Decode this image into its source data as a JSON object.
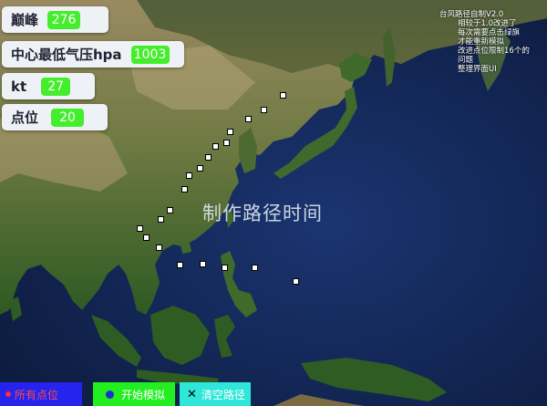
{
  "stats": {
    "peak": {
      "label": "巅峰",
      "value": "276"
    },
    "pressure": {
      "label": "中心最低气压hpa",
      "value": "1003"
    },
    "kt": {
      "label": "kt",
      "value": "27"
    },
    "points": {
      "label": "点位",
      "value": "20"
    }
  },
  "info": {
    "title": "台风路径自制V2.0",
    "notes": [
      "相较于1.0改进了",
      "每次需要点击绿旗",
      "才能重新模拟",
      "改进点位限制16个的",
      "问题",
      "整理界面UI"
    ]
  },
  "overlay_title": "制作路径时间",
  "buttons": {
    "all_points": {
      "label": "所有点位",
      "icon": "red-dot-icon"
    },
    "start": {
      "label": "开始模拟",
      "icon": "blue-dot-icon"
    },
    "clear": {
      "label": "清空路径",
      "icon": "x-icon"
    }
  },
  "track_point_count": 20,
  "colors": {
    "value_badge": "#44ee2c",
    "btn_all": "#2424ee",
    "btn_start": "#22ee22",
    "btn_clear": "#2fe6d9",
    "ocean": "#14285a"
  }
}
